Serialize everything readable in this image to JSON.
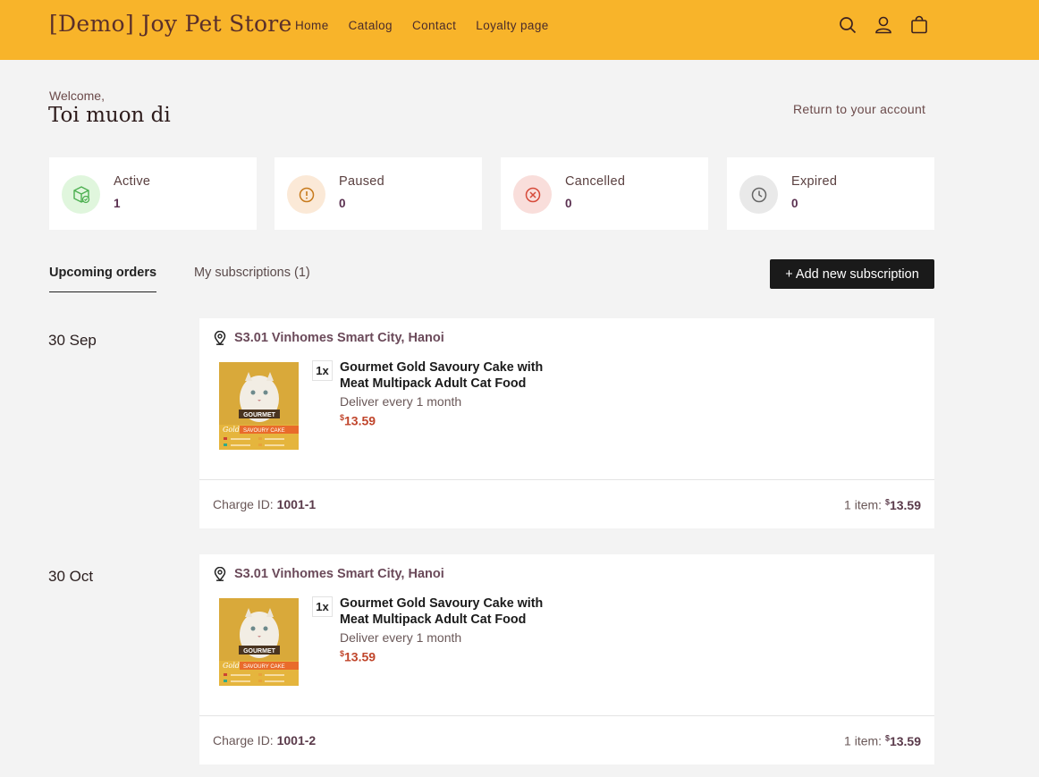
{
  "header": {
    "logo": "[Demo] Joy Pet Store",
    "nav": [
      "Home",
      "Catalog",
      "Contact",
      "Loyalty page"
    ],
    "icons": [
      "search-icon",
      "account-icon",
      "cart-icon"
    ]
  },
  "account": {
    "welcome": "Welcome,",
    "name": "Toi muon di",
    "return_link": "Return to your account"
  },
  "stats": [
    {
      "label": "Active",
      "count": "1",
      "icon": "package-icon",
      "color": "#4caf50",
      "bg": "#e0f6dd"
    },
    {
      "label": "Paused",
      "count": "0",
      "icon": "alert-icon",
      "color": "#c77a1b",
      "bg": "#fbe9d7"
    },
    {
      "label": "Cancelled",
      "count": "0",
      "icon": "x-circle-icon",
      "color": "#d64a3a",
      "bg": "#f9dedb"
    },
    {
      "label": "Expired",
      "count": "0",
      "icon": "clock-icon",
      "color": "#666666",
      "bg": "#e9e9e9"
    }
  ],
  "tabs": {
    "upcoming": "Upcoming orders",
    "subscriptions": "My subscriptions (1)"
  },
  "add_button": "+ Add new subscription",
  "orders": [
    {
      "date": "30 Sep",
      "address": "S3.01 Vinhomes Smart City, Hanoi",
      "qty": "1x",
      "product": "Gourmet Gold Savoury Cake with Meat Multipack Adult Cat Food",
      "frequency": "Deliver every 1 month",
      "price_currency": "$",
      "price_value": "13.59",
      "charge_label": "Charge ID:",
      "charge_id": "1001-1",
      "items_label": "1 item:",
      "total_currency": "$",
      "total_value": "13.59"
    },
    {
      "date": "30 Oct",
      "address": "S3.01 Vinhomes Smart City, Hanoi",
      "qty": "1x",
      "product": "Gourmet Gold Savoury Cake with Meat Multipack Adult Cat Food",
      "frequency": "Deliver every 1 month",
      "price_currency": "$",
      "price_value": "13.59",
      "charge_label": "Charge ID:",
      "charge_id": "1001-2",
      "items_label": "1 item:",
      "total_currency": "$",
      "total_value": "13.59"
    }
  ],
  "product_image_text": {
    "brand": "GOURMET",
    "line": "Gold",
    "variant": "SAVOURY CAKE"
  }
}
